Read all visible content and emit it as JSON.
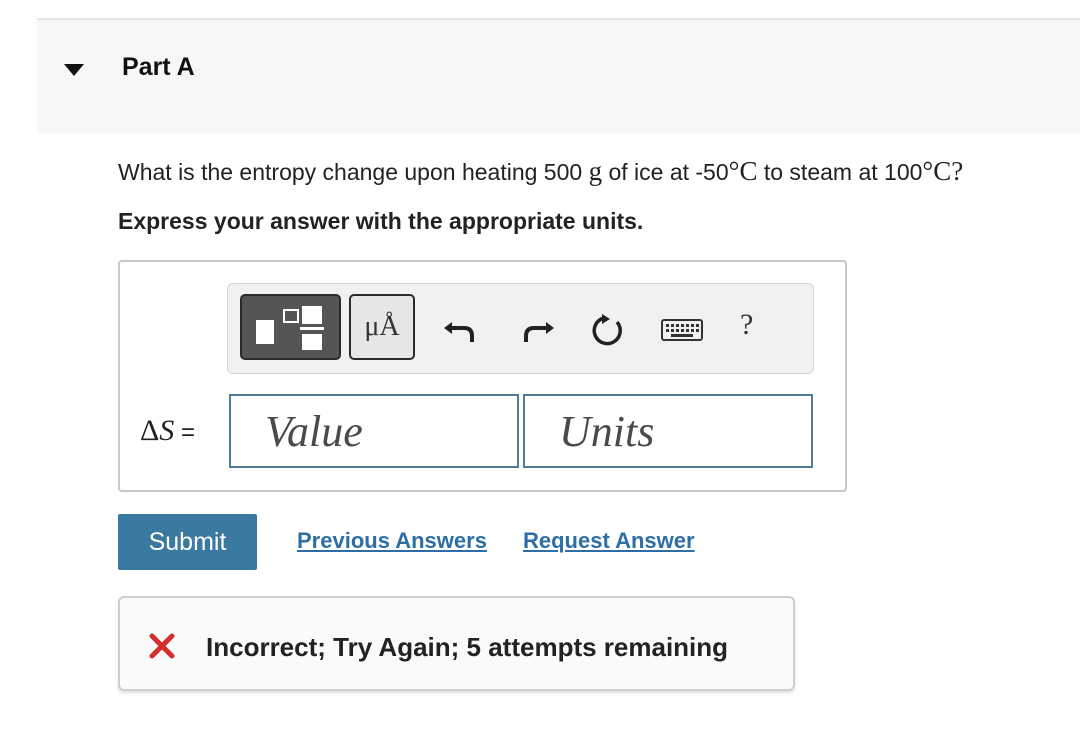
{
  "part": {
    "title": "Part A"
  },
  "question": {
    "text_before": "What is the entropy change upon heating 500 ",
    "unit_g": "g",
    "text_mid": " of ice at -50",
    "deg1": "°",
    "unit_c1": "C",
    "text_after": " to steam at 100",
    "deg2": "°",
    "unit_c2": "C",
    "qmark": "?"
  },
  "instruction": "Express your answer with the appropriate units.",
  "toolbar": {
    "units_label": "μÅ",
    "help_label": "?",
    "icons": [
      "templates-icon",
      "units-icon",
      "undo-icon",
      "redo-icon",
      "reset-icon",
      "keyboard-icon",
      "help-icon"
    ]
  },
  "answer": {
    "label_greek": "Δ",
    "label_symbol": "S",
    "label_equals": " =",
    "value_placeholder": "Value",
    "units_placeholder": "Units"
  },
  "actions": {
    "submit_label": "Submit",
    "previous_answers": "Previous Answers",
    "request_answer": "Request Answer"
  },
  "feedback": {
    "message": "Incorrect; Try Again; 5 attempts remaining",
    "status_color": "#d32f2f"
  },
  "colors": {
    "accent": "#3a7aa0",
    "link": "#2e6ea6",
    "input_border": "#4f7d96"
  }
}
